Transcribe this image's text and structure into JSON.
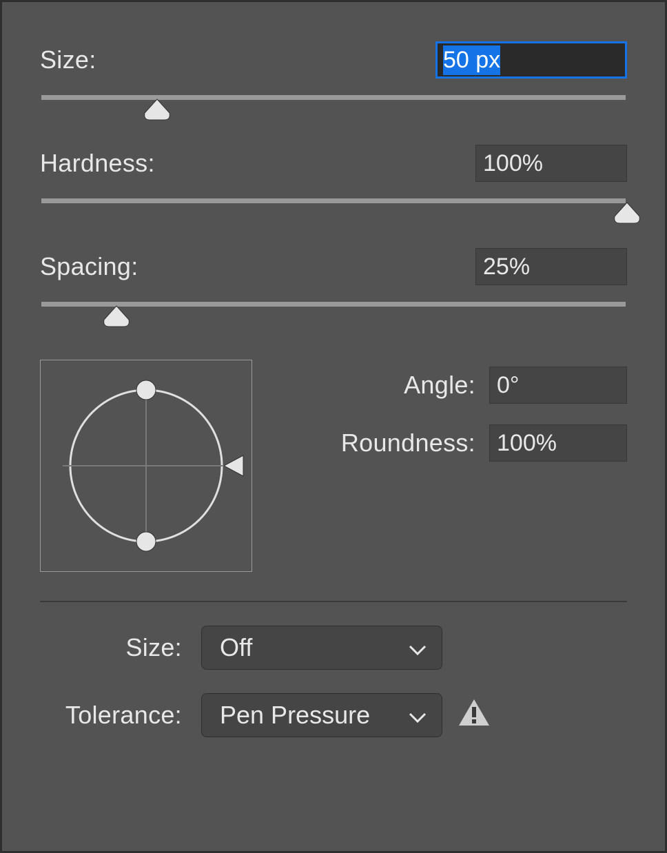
{
  "size": {
    "label": "Size:",
    "value": "50 px",
    "slider_pct": 20
  },
  "hardness": {
    "label": "Hardness:",
    "value": "100%",
    "slider_pct": 100
  },
  "spacing": {
    "label": "Spacing:",
    "value": "25%",
    "slider_pct": 13
  },
  "angle": {
    "label": "Angle:",
    "value": "0°"
  },
  "roundness": {
    "label": "Roundness:",
    "value": "100%"
  },
  "dynamics": {
    "size": {
      "label": "Size:",
      "selected": "Off"
    },
    "tolerance": {
      "label": "Tolerance:",
      "selected": "Pen Pressure",
      "warning": true
    }
  }
}
